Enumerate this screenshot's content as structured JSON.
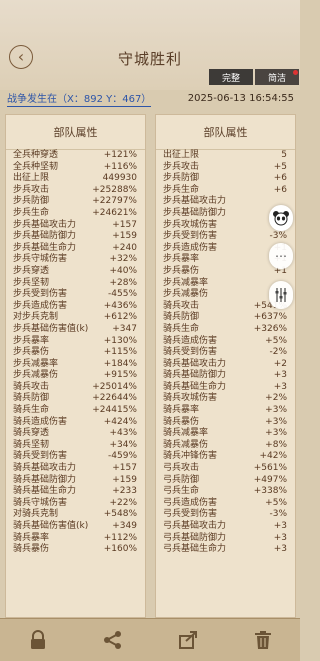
{
  "header": {
    "title": "守城胜利",
    "tabs": [
      {
        "label": "完整"
      },
      {
        "label": "简洁"
      }
    ]
  },
  "battle": {
    "location": "战争发生在（X：892 Y：467）",
    "time": "2025-06-13 16:54:55"
  },
  "left_panel": {
    "title": "部队属性",
    "rows": [
      {
        "label": "全兵种穿透",
        "value": "+121%"
      },
      {
        "label": "全兵种坚韧",
        "value": "+116%"
      },
      {
        "label": "出征上限",
        "value": "449930"
      },
      {
        "label": "步兵攻击",
        "value": "+25288%"
      },
      {
        "label": "步兵防御",
        "value": "+22797%"
      },
      {
        "label": "步兵生命",
        "value": "+24621%"
      },
      {
        "label": "步兵基础攻击力",
        "value": "+157"
      },
      {
        "label": "步兵基础防御力",
        "value": "+159"
      },
      {
        "label": "步兵基础生命力",
        "value": "+240"
      },
      {
        "label": "步兵守城伤害",
        "value": "+32%"
      },
      {
        "label": "步兵穿透",
        "value": "+40%"
      },
      {
        "label": "步兵坚韧",
        "value": "+28%"
      },
      {
        "label": "步兵受到伤害",
        "value": "-455%"
      },
      {
        "label": "步兵造成伤害",
        "value": "+436%"
      },
      {
        "label": "对步兵克制",
        "value": "+612%"
      },
      {
        "label": "步兵基础伤害值(k)",
        "value": "+347"
      },
      {
        "label": "步兵暴率",
        "value": "+130%"
      },
      {
        "label": "步兵暴伤",
        "value": "+115%"
      },
      {
        "label": "步兵减暴率",
        "value": "+184%"
      },
      {
        "label": "步兵减暴伤",
        "value": "+915%"
      },
      {
        "label": "骑兵攻击",
        "value": "+25014%"
      },
      {
        "label": "骑兵防御",
        "value": "+22644%"
      },
      {
        "label": "骑兵生命",
        "value": "+24415%"
      },
      {
        "label": "骑兵造成伤害",
        "value": "+424%"
      },
      {
        "label": "骑兵穿透",
        "value": "+43%"
      },
      {
        "label": "骑兵坚韧",
        "value": "+34%"
      },
      {
        "label": "骑兵受到伤害",
        "value": "-459%"
      },
      {
        "label": "骑兵基础攻击力",
        "value": "+157"
      },
      {
        "label": "骑兵基础防御力",
        "value": "+159"
      },
      {
        "label": "骑兵基础生命力",
        "value": "+233"
      },
      {
        "label": "骑兵守城伤害",
        "value": "+22%"
      },
      {
        "label": "对骑兵克制",
        "value": "+548%"
      },
      {
        "label": "骑兵基础伤害值(k)",
        "value": "+349"
      },
      {
        "label": "骑兵暴率",
        "value": "+112%"
      },
      {
        "label": "骑兵暴伤",
        "value": "+160%"
      }
    ]
  },
  "right_panel": {
    "title": "部队属性",
    "rows": [
      {
        "label": "出征上限",
        "value": "5"
      },
      {
        "label": "步兵攻击",
        "value": "+5"
      },
      {
        "label": "步兵防御",
        "value": "+6"
      },
      {
        "label": "步兵生命",
        "value": "+6"
      },
      {
        "label": "步兵基础攻击力",
        "value": ""
      },
      {
        "label": "步兵基础防御力",
        "value": ""
      },
      {
        "label": "步兵攻城伤害",
        "value": ""
      },
      {
        "label": "步兵受到伤害",
        "value": "-3%"
      },
      {
        "label": "步兵造成伤害",
        "value": "+1"
      },
      {
        "label": "步兵暴率",
        "value": "+1"
      },
      {
        "label": "步兵暴伤",
        "value": "+1"
      },
      {
        "label": "步兵减暴率",
        "value": ""
      },
      {
        "label": "步兵减暴伤",
        "value": "+"
      },
      {
        "label": "骑兵攻击",
        "value": "+541%"
      },
      {
        "label": "骑兵防御",
        "value": "+637%"
      },
      {
        "label": "骑兵生命",
        "value": "+326%"
      },
      {
        "label": "骑兵造成伤害",
        "value": "+5%"
      },
      {
        "label": "骑兵受到伤害",
        "value": "-2%"
      },
      {
        "label": "骑兵基础攻击力",
        "value": "+2"
      },
      {
        "label": "骑兵基础防御力",
        "value": "+3"
      },
      {
        "label": "骑兵基础生命力",
        "value": "+3"
      },
      {
        "label": "骑兵攻城伤害",
        "value": "+2%"
      },
      {
        "label": "骑兵暴率",
        "value": "+3%"
      },
      {
        "label": "骑兵暴伤",
        "value": "+3%"
      },
      {
        "label": "骑兵减暴率",
        "value": "+3%"
      },
      {
        "label": "骑兵减暴伤",
        "value": "+8%"
      },
      {
        "label": "骑兵冲锋伤害",
        "value": "+42%"
      },
      {
        "label": "弓兵攻击",
        "value": "+561%"
      },
      {
        "label": "弓兵防御",
        "value": "+497%"
      },
      {
        "label": "弓兵生命",
        "value": "+338%"
      },
      {
        "label": "弓兵造成伤害",
        "value": "+5%"
      },
      {
        "label": "弓兵受到伤害",
        "value": "-3%"
      },
      {
        "label": "弓兵基础攻击力",
        "value": "+3"
      },
      {
        "label": "弓兵基础防御力",
        "value": "+3"
      },
      {
        "label": "弓兵基础生命力",
        "value": "+3"
      }
    ]
  },
  "colors": {
    "background": "#d9cbb0",
    "panel": "#eee2cc",
    "text": "#5a3a22",
    "link": "#2e55a8",
    "tab_dark": "#3d3a37",
    "toolbar": "#c9b592"
  },
  "icons": {
    "back": "chevron-left-icon",
    "lock": "lock-icon",
    "share": "share-icon",
    "forward": "forward-icon",
    "delete": "trash-icon"
  }
}
